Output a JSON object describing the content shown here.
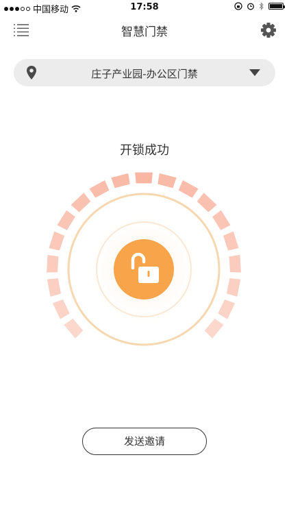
{
  "status_bar": {
    "carrier": "中国移动",
    "time": "17:58"
  },
  "header": {
    "title": "智慧门禁",
    "menu_icon": "list-icon",
    "settings_icon": "gear-icon"
  },
  "location_selector": {
    "icon": "location-pin-icon",
    "value": "庄子产业园-办公区门禁",
    "dropdown_icon": "triangle-down-icon"
  },
  "unlock": {
    "status": "开锁成功",
    "icon": "unlocked-padlock-icon"
  },
  "actions": {
    "send_invite": "发送邀请"
  },
  "colors": {
    "accent": "#f7a44a",
    "segment": "#f9b6a2",
    "ring": "#f6d7b0"
  }
}
